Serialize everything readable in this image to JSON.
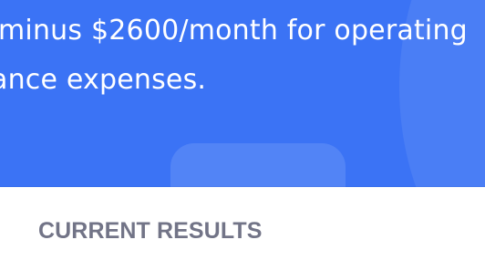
{
  "hero": {
    "line1": "minus $2600/month for operating",
    "line2": "ance expenses."
  },
  "results": {
    "heading": "CURRENT RESULTS"
  }
}
